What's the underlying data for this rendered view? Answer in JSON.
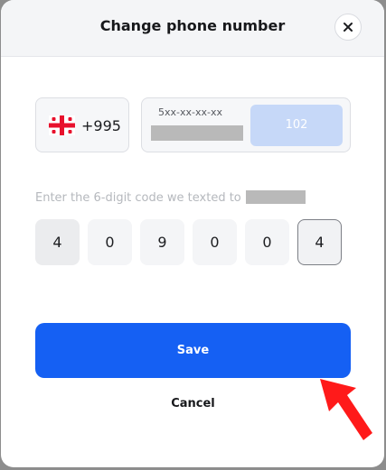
{
  "modal": {
    "title": "Change phone number",
    "close_icon": "close-icon"
  },
  "phone": {
    "country_flag": "georgia-flag-icon",
    "dial_code": "+995",
    "format_hint": "5xx-xx-xx-xx",
    "send_button_label": "102",
    "send_button_color": "#c6d8f8"
  },
  "verification": {
    "instruction": "Enter the 6-digit code we texted to",
    "digits": [
      "4",
      "0",
      "9",
      "0",
      "0",
      "4"
    ]
  },
  "actions": {
    "save_label": "Save",
    "save_color": "#1560f3",
    "cancel_label": "Cancel"
  },
  "annotation": {
    "arrow_icon": "red-pointer-arrow-icon",
    "arrow_color": "#ff1a1a"
  }
}
